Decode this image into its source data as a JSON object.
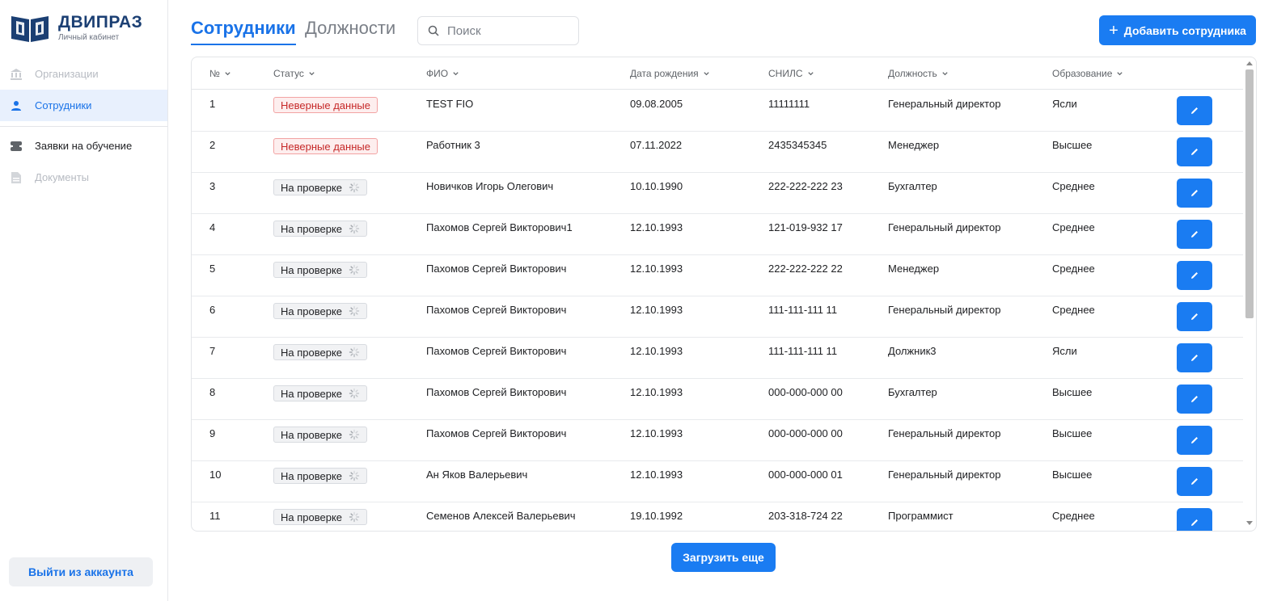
{
  "brand": {
    "title": "ДВИПРАЗ",
    "subtitle": "Личный кабинет",
    "logo_icon": "book-logo-icon"
  },
  "sidebar": {
    "items": [
      {
        "label": "Организации",
        "icon": "bank-icon",
        "state": "disabled"
      },
      {
        "label": "Сотрудники",
        "icon": "user-icon",
        "state": "active"
      },
      {
        "label": "Заявки на обучение",
        "icon": "stack-icon",
        "state": "normal"
      },
      {
        "label": "Документы",
        "icon": "document-icon",
        "state": "disabled"
      }
    ],
    "logout_label": "Выйти из аккаунта"
  },
  "header": {
    "tabs": [
      {
        "label": "Сотрудники",
        "active": true
      },
      {
        "label": "Должности",
        "active": false
      }
    ],
    "search_placeholder": "Поиск",
    "add_button_label": "Добавить сотрудника"
  },
  "table": {
    "columns": [
      "№",
      "Статус",
      "ФИО",
      "Дата рождения",
      "СНИЛС",
      "Должность",
      "Образование"
    ],
    "rows": [
      {
        "num": "1",
        "status": "Неверные данные",
        "status_type": "error",
        "fio": "TEST FIO",
        "dob": "09.08.2005",
        "snils": "11111111",
        "position": "Генеральный директор",
        "education": "Ясли"
      },
      {
        "num": "2",
        "status": "Неверные данные",
        "status_type": "error",
        "fio": "Работник 3",
        "dob": "07.11.2022",
        "snils": "2435345345",
        "position": "Менеджер",
        "education": "Высшее"
      },
      {
        "num": "3",
        "status": "На проверке",
        "status_type": "pending",
        "fio": "Новичков Игорь Олегович",
        "dob": "10.10.1990",
        "snils": "222-222-222 23",
        "position": "Бухгалтер",
        "education": "Среднее"
      },
      {
        "num": "4",
        "status": "На проверке",
        "status_type": "pending",
        "fio": "Пахомов Сергей Викторович1",
        "dob": "12.10.1993",
        "snils": "121-019-932 17",
        "position": "Генеральный директор",
        "education": "Среднее"
      },
      {
        "num": "5",
        "status": "На проверке",
        "status_type": "pending",
        "fio": "Пахомов Сергей Викторович",
        "dob": "12.10.1993",
        "snils": "222-222-222 22",
        "position": "Менеджер",
        "education": "Среднее"
      },
      {
        "num": "6",
        "status": "На проверке",
        "status_type": "pending",
        "fio": "Пахомов Сергей Викторович",
        "dob": "12.10.1993",
        "snils": "111-111-111 11",
        "position": "Генеральный директор",
        "education": "Среднее"
      },
      {
        "num": "7",
        "status": "На проверке",
        "status_type": "pending",
        "fio": "Пахомов Сергей Викторович",
        "dob": "12.10.1993",
        "snils": "111-111-111 11",
        "position": "Должник3",
        "education": "Ясли"
      },
      {
        "num": "8",
        "status": "На проверке",
        "status_type": "pending",
        "fio": "Пахомов Сергей Викторович",
        "dob": "12.10.1993",
        "snils": "000-000-000 00",
        "position": "Бухгалтер",
        "education": "Высшее"
      },
      {
        "num": "9",
        "status": "На проверке",
        "status_type": "pending",
        "fio": "Пахомов Сергей Викторович",
        "dob": "12.10.1993",
        "snils": "000-000-000 00",
        "position": "Генеральный директор",
        "education": "Высшее"
      },
      {
        "num": "10",
        "status": "На проверке",
        "status_type": "pending",
        "fio": "Ан Яков Валерьевич",
        "dob": "12.10.1993",
        "snils": "000-000-000 01",
        "position": "Генеральный директор",
        "education": "Высшее"
      },
      {
        "num": "11",
        "status": "На проверке",
        "status_type": "pending",
        "fio": "Семенов Алексей Валерьевич",
        "dob": "19.10.1992",
        "snils": "203-318-724 22",
        "position": "Программист",
        "education": "Среднее"
      }
    ]
  },
  "load_more_label": "Загрузить еще",
  "colors": {
    "accent": "#1a7cf2",
    "active_bg": "#e8f0fd",
    "error": "#c62828",
    "brand": "#1b3f73"
  }
}
